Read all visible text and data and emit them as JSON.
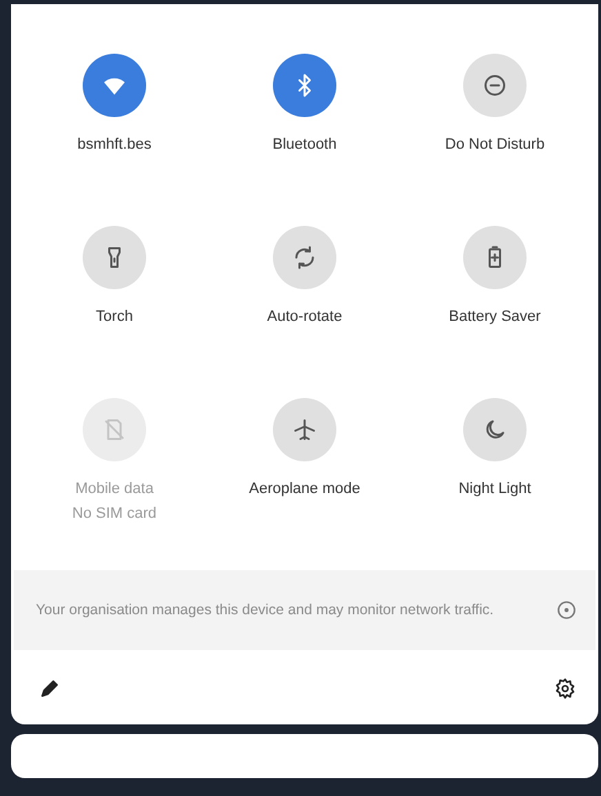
{
  "tiles": [
    {
      "label": "bsmhft.bes",
      "on": true,
      "disabled": false
    },
    {
      "label": "Bluetooth",
      "on": true,
      "disabled": false
    },
    {
      "label": "Do Not Disturb",
      "on": false,
      "disabled": false
    },
    {
      "label": "Torch",
      "on": false,
      "disabled": false
    },
    {
      "label": "Auto-rotate",
      "on": false,
      "disabled": false
    },
    {
      "label": "Battery Saver",
      "on": false,
      "disabled": false
    },
    {
      "label": "Mobile data",
      "sublabel": "No SIM card",
      "on": false,
      "disabled": true
    },
    {
      "label": "Aeroplane mode",
      "on": false,
      "disabled": false
    },
    {
      "label": "Night Light",
      "on": false,
      "disabled": false
    }
  ],
  "notice": {
    "text": "Your organisation manages this device and may monitor network traffic."
  }
}
